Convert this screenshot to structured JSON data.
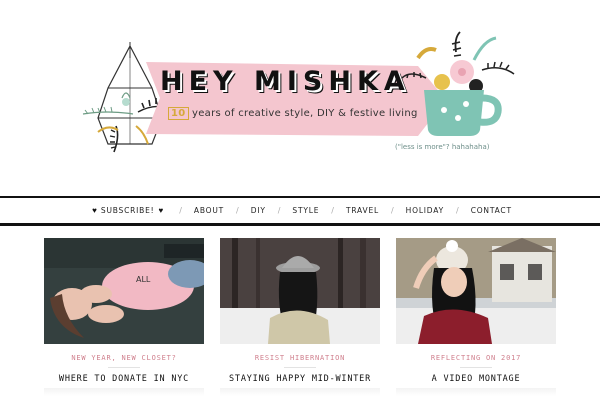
{
  "header": {
    "logo_title": "HEY MISHKA",
    "tagline_prefix": "10",
    "tagline_rest": " years of creative style, DIY & festive living",
    "subnote": "(\"less is more\"? hahahaha)"
  },
  "nav": {
    "items": [
      {
        "label": "SUBSCRIBE!"
      },
      {
        "label": "ABOUT"
      },
      {
        "label": "DIY"
      },
      {
        "label": "STYLE"
      },
      {
        "label": "TRAVEL"
      },
      {
        "label": "HOLIDAY"
      },
      {
        "label": "CONTACT"
      }
    ],
    "heart": "♥",
    "separator": "/"
  },
  "posts": [
    {
      "category": "NEW YEAR, NEW CLOSET?",
      "title": "WHERE TO DONATE IN NYC"
    },
    {
      "category": "RESIST HIBERNATION",
      "title": "STAYING HAPPY MID-WINTER"
    },
    {
      "category": "REFLECTING ON 2017",
      "title": "A VIDEO MONTAGE"
    }
  ],
  "colors": {
    "banner_pink": "#f4c6cf",
    "category_pink": "#d0808e",
    "mug_teal": "#7fc4b4",
    "accent_gold": "#d6a93a"
  }
}
